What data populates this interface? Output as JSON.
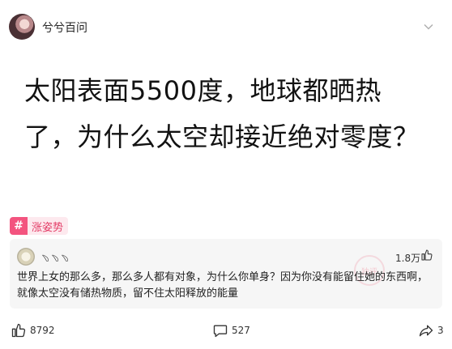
{
  "header": {
    "username": "兮兮百问"
  },
  "question": {
    "title": "太阳表面5500度，地球都晒热了，为什么太空却接近绝对零度？"
  },
  "tag": {
    "icon_glyph": "#",
    "label": "涨姿势",
    "color": "#f3547f"
  },
  "answer": {
    "user": "﹆﹆﹆",
    "likes": "1.8万",
    "text": "世界上女的那么多，那么多人都有对象，为什么你单身？因为你没有能留住她的东西啊，就像太空没有储热物质，留不住太阳释放的能量",
    "watermark": "独评"
  },
  "footer": {
    "likes": "8792",
    "comments": "527",
    "shares": "3"
  }
}
